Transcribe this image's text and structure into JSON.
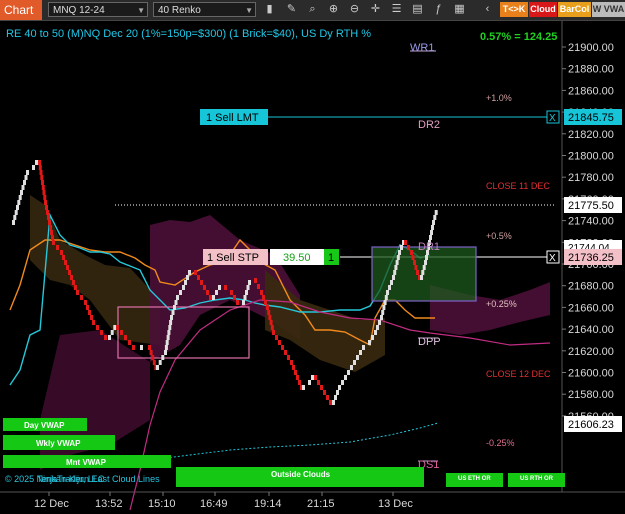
{
  "toolbar": {
    "title": "Chart",
    "instrument": "MNQ 12-24",
    "bar_type": "40 Renko",
    "btn_tk": "T<>K",
    "btn_cloud": "Cloud",
    "btn_barcol": "BarCol",
    "btn_wvwa": "W VWA",
    "icons": [
      "bars-icon",
      "pencil-icon",
      "magnify-icon",
      "zoom-in-icon",
      "zoom-out-icon",
      "crosshair-icon",
      "properties-icon",
      "templates-icon",
      "indicators-icon",
      "strategies-icon"
    ]
  },
  "chart": {
    "header": "RE 40 to 50 (M)NQ Dec 20 (1%=150p=$300) (1 Brick=$40), US Dy RTH %",
    "pct_readout": "0.57% = 124.25",
    "watermark": "© 2025 NinjaTrader, LLC",
    "footer_label": "Tenkan-Kijun East Cloud Lines",
    "colors": {
      "up_brick": "#e0e0e0",
      "down_brick": "#e01818",
      "ask_line": "#17c5d8",
      "price_tag": "#ffffff",
      "level_pink": "#d070a0",
      "level_red": "#e03030",
      "pivot": "#c080c0",
      "green": "#16c816"
    }
  },
  "price_axis": {
    "ticks": [
      "21900.00",
      "21880.00",
      "21860.00",
      "21840.00",
      "21820.00",
      "21800.00",
      "21780.00",
      "21760.00",
      "21740.00",
      "21720.00",
      "21700.00",
      "21680.00",
      "21660.00",
      "21640.00",
      "21620.00",
      "21600.00",
      "21580.00",
      "21560.00"
    ],
    "tags": {
      "sell_lmt": "21845.75",
      "last": "21775.50",
      "hidden": "21744.04",
      "sell_stp": "21736.25",
      "vwap": "21606.23"
    }
  },
  "time_axis": {
    "ticks": [
      "12 Dec",
      "13:52",
      "15:10",
      "16:49",
      "19:14",
      "21:15",
      "13 Dec"
    ]
  },
  "levels": {
    "wr1": "WR1",
    "dr2": "DR2",
    "dr1": "DR1",
    "dpp": "DPP",
    "ds1": "DS1",
    "pct1": "+1.0%",
    "pct05": "+0.5%",
    "pct025": "+0.25%",
    "pctm025": "-0.25%",
    "close11": "CLOSE 11 DEC",
    "close12": "CLOSE 12 DEC"
  },
  "orders": {
    "sell_lmt": "1 Sell LMT",
    "sell_stp": "1 Sell STP",
    "pnl": "39.50",
    "qty": "1",
    "close_x": "X"
  },
  "buttons": {
    "day_vwap": "Day VWAP",
    "wkly_vwap": "Wkly VWAP",
    "mnt_vwap": "Mnt VWAP",
    "outside_clouds": "Outside Clouds",
    "us_eth": "US ETH OR",
    "us_rth": "US RTH OR"
  }
}
